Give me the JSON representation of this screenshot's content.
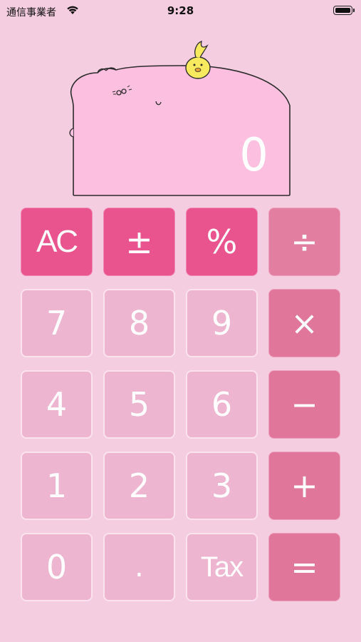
{
  "status_bar": {
    "carrier": "通信事業者",
    "time": "9:28",
    "wifi_icon": "wifi-icon",
    "battery_icon": "battery-icon"
  },
  "display": {
    "value": "0"
  },
  "keys": {
    "ac": "AC",
    "plus_minus": "±",
    "percent": "%",
    "divide": "÷",
    "seven": "7",
    "eight": "8",
    "nine": "9",
    "multiply": "×",
    "four": "4",
    "five": "5",
    "six": "6",
    "minus": "−",
    "one": "1",
    "two": "2",
    "three": "3",
    "plus": "+",
    "zero": "0",
    "decimal": ".",
    "tax": "Tax",
    "equals": "="
  },
  "colors": {
    "background": "#f5cde0",
    "function_key": "#e9548e",
    "number_key": "#edb5cf",
    "operator_key": "#e07699",
    "display_fill": "#fdbfdf",
    "chick": "#f7ea5e"
  }
}
